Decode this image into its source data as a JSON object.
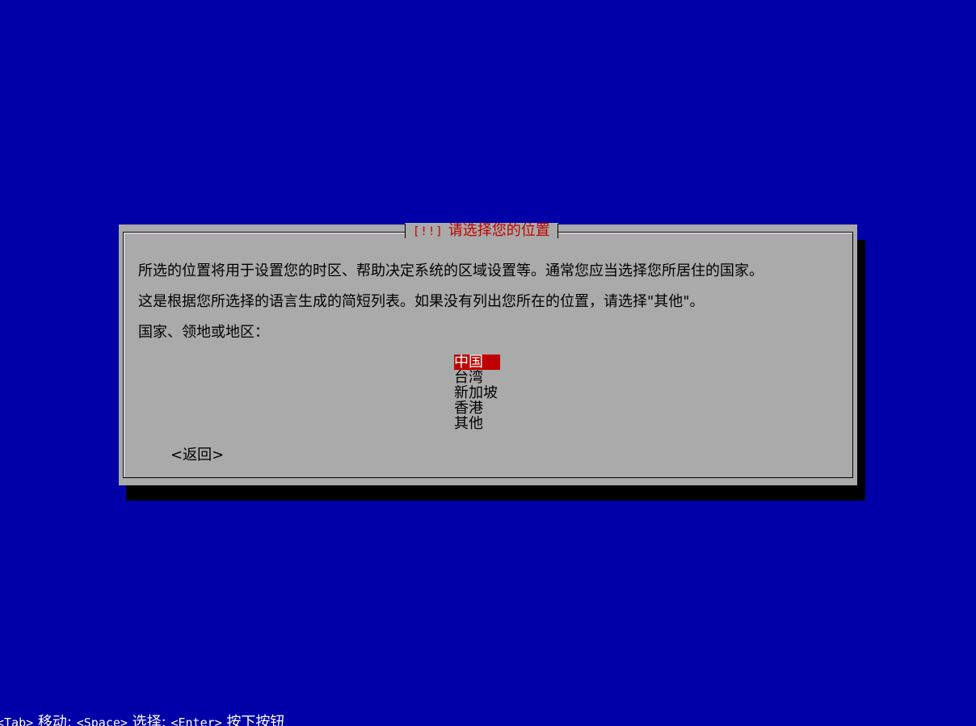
{
  "dialog": {
    "title_prefix": "[!!]",
    "title": "请选择您的位置",
    "description_1": "所选的位置将用于设置您的时区、帮助决定系统的区域设置等。通常您应当选择您所居住的国家。",
    "description_2": "这是根据您所选择的语言生成的简短列表。如果没有列出您所在的位置，请选择\"其他\"。",
    "prompt": "国家、领地或地区："
  },
  "list": {
    "items": [
      "中国",
      "台湾",
      "新加坡",
      "香港",
      "其他"
    ],
    "selected": "中国"
  },
  "buttons": {
    "back": "<返回>"
  },
  "help": {
    "tab_key": "<Tab>",
    "tab_action": "移动;",
    "space_key": "<Space>",
    "space_action": "选择;",
    "enter_key": "<Enter>",
    "enter_action": "按下按钮"
  },
  "colors": {
    "background": "#0000a8",
    "dialog": "#aaaaaa",
    "accent": "#c00000",
    "text": "#000000"
  }
}
